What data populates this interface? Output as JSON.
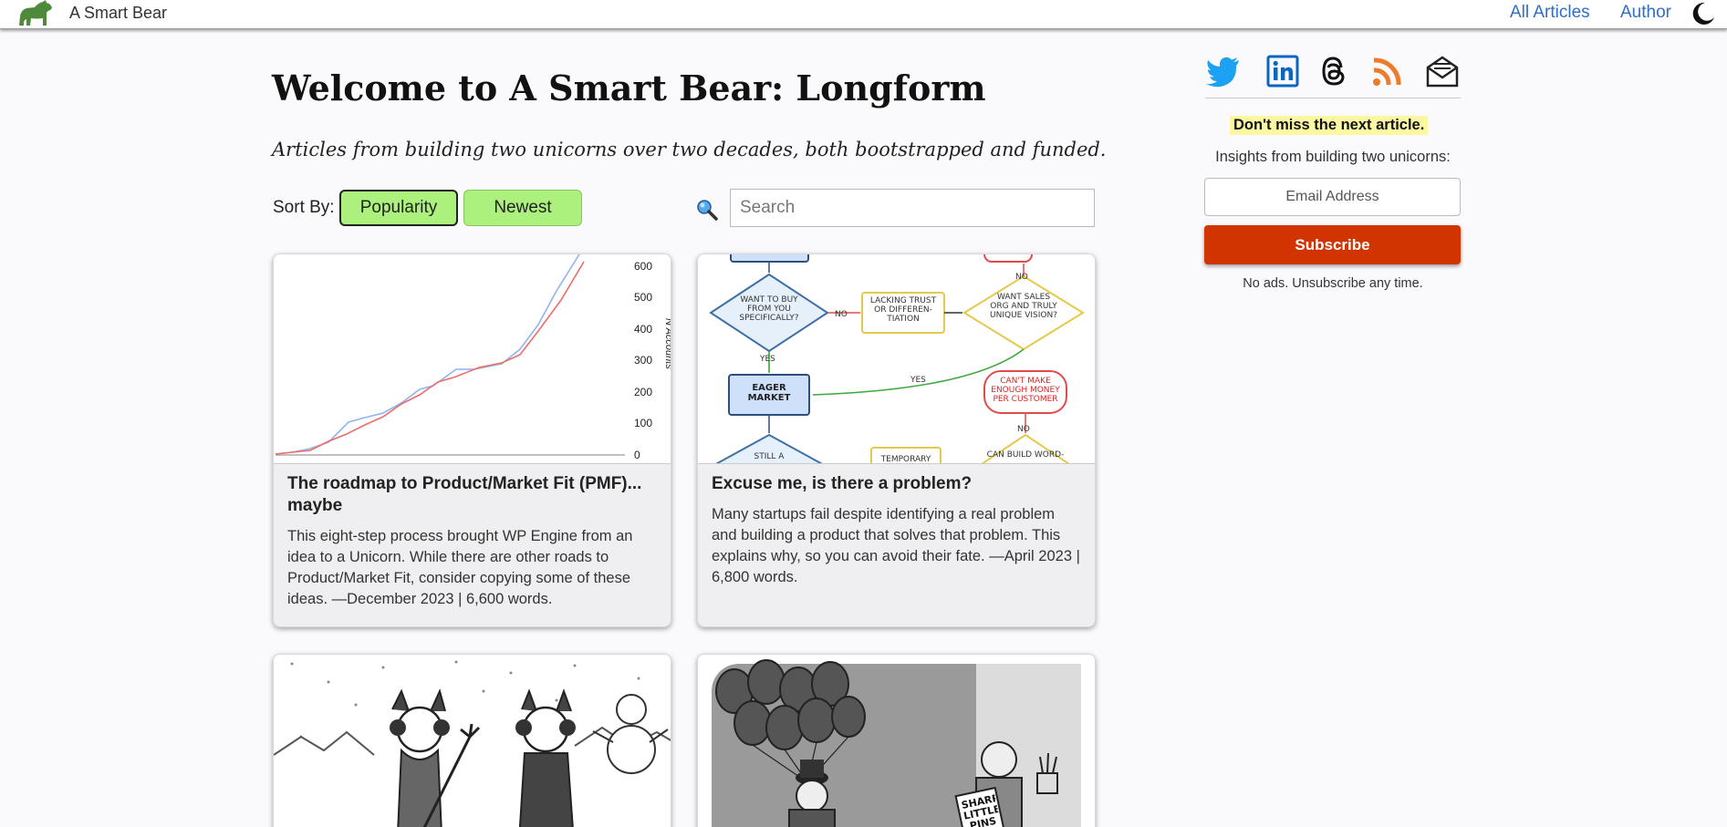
{
  "header": {
    "site_name": "A Smart Bear",
    "nav": [
      {
        "label": "All Articles"
      },
      {
        "label": "Author"
      }
    ]
  },
  "main": {
    "title": "Welcome to A Smart Bear: Longform",
    "tagline": "Articles from building two unicorns over two decades, both bootstrapped and funded.",
    "sort_label": "Sort By:",
    "sort_options": [
      "Popularity",
      "Newest"
    ],
    "search_placeholder": "Search"
  },
  "articles": [
    {
      "title": "The roadmap to Product/Market Fit (PMF)... maybe",
      "description": "This eight-step process brought WP Engine from an idea to a Unicorn. While there are other roads to Product/Market Fit, consider copying some of these ideas. —December 2023 | 6,600 words.",
      "image": {
        "y_ticks": [
          "600",
          "500",
          "400",
          "300",
          "200",
          "100",
          "0"
        ],
        "y_label": "N Accounts"
      }
    },
    {
      "title": "Excuse me, is there a problem?",
      "description": "Many startups fail despite identifying a real problem and building a product that solves that problem. This explains why, so you can avoid their fate. —April 2023 | 6,800 words.",
      "image": {
        "labels": {
          "want": "WANT TO BUY FROM YOU SPECIFICALLY?",
          "lacking": "LACKING TRUST OR DIFFEREN-TIATION",
          "sales": "WANT SALES ORG AND TRULY UNIQUE VISION?",
          "eager": "EAGER MARKET",
          "cant": "CAN'T MAKE ENOUGH MONEY PER CUSTOMER",
          "still": "STILL A",
          "temporary": "TEMPORARY",
          "can": "CAN BUILD WORD-",
          "no": "NO",
          "yes": "YES"
        }
      }
    },
    {
      "title": "",
      "description": ""
    },
    {
      "title": "",
      "description": "",
      "image": {
        "sign": "SHARP LITTLE PINS"
      }
    }
  ],
  "sidebar": {
    "social": [
      "twitter-icon",
      "linkedin-icon",
      "threads-icon",
      "rss-icon",
      "email-icon"
    ],
    "cta": "Don't miss the next article.",
    "insights": "Insights from building two unicorns:",
    "email_placeholder": "Email Address",
    "subscribe_label": "Subscribe",
    "no_ads": "No ads. Unsubscribe any time."
  },
  "colors": {
    "accent_link": "#2e6fc4",
    "sort_button": "#acf07e",
    "subscribe": "#d13400",
    "highlight": "#fbf7a3"
  }
}
